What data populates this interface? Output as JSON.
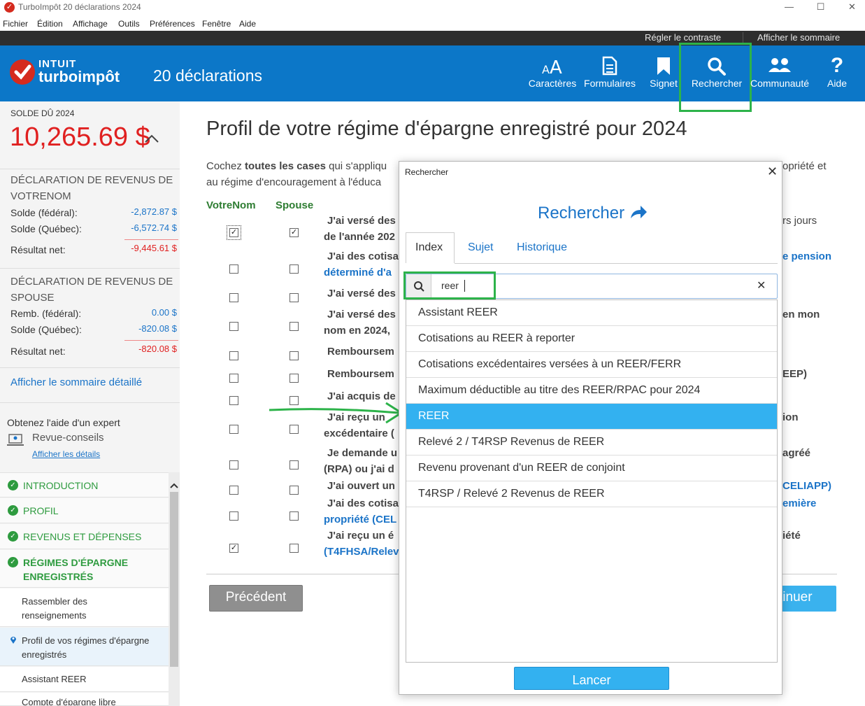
{
  "window": {
    "title": "TurboImpôt 20 déclarations 2024",
    "controls": {
      "minimize": "—",
      "maximize": "☐",
      "close": "✕"
    }
  },
  "menubar": [
    "Fichier",
    "Édition",
    "Affichage",
    "Outils",
    "Préférences",
    "Fenêtre",
    "Aide"
  ],
  "topstrip": {
    "contrast": "Régler le contraste",
    "summary": "Afficher le sommaire"
  },
  "header": {
    "logo_brand": "INTUIT",
    "logo_product": "turboimpôt",
    "return_count": "20 déclarations",
    "buttons": [
      {
        "label": "Caractères",
        "icon": "font-size-icon"
      },
      {
        "label": "Formulaires",
        "icon": "document-icon"
      },
      {
        "label": "Signet",
        "icon": "bookmark-icon"
      },
      {
        "label": "Rechercher",
        "icon": "search-icon"
      },
      {
        "label": "Communauté",
        "icon": "community-icon"
      },
      {
        "label": "Aide",
        "icon": "help-icon"
      }
    ]
  },
  "sidebar": {
    "balance_label": "SOLDE DÛ 2024",
    "balance_value": "10,265.69 $",
    "ret1": {
      "heading": "DÉCLARATION DE REVENUS DE VOTRENOM",
      "rows": [
        {
          "label": "Solde (fédéral):",
          "value": "-2,872.87 $"
        },
        {
          "label": "Solde (Québec):",
          "value": "-6,572.74 $"
        }
      ],
      "net_label": "Résultat net:",
      "net_value": "-9,445.61 $"
    },
    "ret2": {
      "heading": "DÉCLARATION DE REVENUS DE SPOUSE",
      "rows": [
        {
          "label": "Remb. (fédéral):",
          "value": "0.00 $"
        },
        {
          "label": "Solde (Québec):",
          "value": "-820.08 $"
        }
      ],
      "net_label": "Résultat net:",
      "net_value": "-820.08 $"
    },
    "detail_link": "Afficher le sommaire détaillé",
    "expert": {
      "title": "Obtenez l'aide d'un expert",
      "service": "Revue-conseils",
      "link": "Afficher les détails"
    },
    "nav": [
      {
        "label": "INTRODUCTION",
        "done": true
      },
      {
        "label": "PROFIL",
        "done": true
      },
      {
        "label": "REVENUS ET DÉPENSES",
        "done": true
      },
      {
        "label": "RÉGIMES D'ÉPARGNE ENREGISTRÉS",
        "done": true
      },
      {
        "label": "Rassembler des renseignements",
        "done": false
      },
      {
        "label": "Profil de vos régimes d'épargne enregistrés",
        "done": false,
        "current": true
      },
      {
        "label": "Assistant REER",
        "done": false
      },
      {
        "label": "Compte d'épargne libre",
        "done": false
      }
    ]
  },
  "main": {
    "title": "Profil de votre régime d'épargne enregistré pour 2024",
    "intro_a": "Cochez ",
    "intro_b": "toutes les cases",
    "intro_c": " qui s'appliqu",
    "intro_line2": "au régime d'encouragement à l'éduca",
    "intro_right": "opriété et",
    "col1": "VotreNom",
    "col2": "Spouse",
    "questions": [
      {
        "t": "J'ai versé des",
        "c1": true,
        "c2": true
      },
      {
        "t": "J'ai des cotisa",
        "c1": false,
        "c2": false
      },
      {
        "t": "J'ai versé des",
        "c1": false,
        "c2": false
      },
      {
        "t": "J'ai versé des",
        "c1": false,
        "c2": false
      },
      {
        "t": "Remboursem",
        "c1": false,
        "c2": false
      },
      {
        "t": "Remboursem",
        "c1": false,
        "c2": false
      },
      {
        "t": "J'ai acquis de",
        "c1": false,
        "c2": false
      },
      {
        "t": "J'ai reçu un",
        "c1": false,
        "c2": false
      },
      {
        "t": "Je demande u",
        "c1": false,
        "c2": false
      },
      {
        "t": "J'ai ouvert un",
        "c1": false,
        "c2": false
      },
      {
        "t": "J'ai des cotisa",
        "c1": false,
        "c2": false
      },
      {
        "t": "J'ai reçu un é",
        "c1": true,
        "c2": false
      }
    ],
    "q_line2": {
      "q0": "de l'année 202",
      "q1": "déterminé d'a",
      "q3": "nom en 2024,",
      "q7": "excédentaire (",
      "q8": "(RPA) ou j'ai d",
      "q10": "propriété (CEL",
      "q11": "(T4FHSA/Relev"
    },
    "right_fragments": {
      "r0": "rs jours",
      "r1": "e pension",
      "r3": "en mon",
      "r5": "EEP)",
      "r7": "ion",
      "r8": "agréé",
      "r9": "CELIAPP)",
      "r10": "emière",
      "r11": "iété"
    },
    "prev_button": "Précédent",
    "next_button": "tinuer"
  },
  "dialog": {
    "window_title": "Rechercher",
    "heading": "Rechercher",
    "tabs": [
      "Index",
      "Sujet",
      "Historique"
    ],
    "active_tab": "Index",
    "query": "reer",
    "results": [
      "Assistant REER",
      "Cotisations au REER à reporter",
      "Cotisations excédentaires versées à un REER/FERR",
      "Maximum déductible au titre des REER/RPAC pour 2024",
      "REER",
      "Relevé 2 / T4RSP Revenus de REER",
      "Revenu provenant d'un REER de conjoint",
      "T4RSP / Relevé 2 Revenus de REER"
    ],
    "selected_index": 4,
    "launch_button": "Lancer"
  },
  "colors": {
    "header_blue": "#0c77c8",
    "accent_green": "#2db34a",
    "selection_blue": "#33b1f0",
    "balance_red": "#e02020"
  }
}
